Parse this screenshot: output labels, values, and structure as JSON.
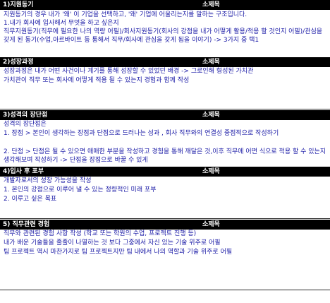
{
  "sections": [
    {
      "title": "1)지원동기",
      "subtitle": "소제목",
      "lines": [
        "지원동기의 경우 내가 '왜' 이 기업을 선택하고, '왜' 기업에 어울리는지를 말하는 구조입니다.",
        "1.내가 회사에 입사해서 무엇을 하고 싶은지",
        "직무지원동기(직무에 필요한 나의 역량 어필)/회사지원동기(회사의 강점을 내가 어떻게 활용/적용 할 것인지 어필)/관심을 갖게 된 동기(수업,아르바이트 등 통해서 직무/회사에 관심을 갖게 됨을 이야기) -> 3가지 중 택1"
      ]
    },
    {
      "title": "2)성장과정",
      "subtitle": "소제목",
      "lines": [
        "성장과정은 내가 어떤 사건이나 계기를 통해 성장할 수 있었던 배경 -> 그로인해 형성된 가치관",
        "가치관이 직무 또는 회사에 어떻게 적용 될 수 있는지 경험과 함께 작성"
      ]
    },
    {
      "title": "3)성격의 장단점",
      "subtitle": "소제목",
      "lines": [
        "성격의 장단점은",
        "1. 장점 > 본인이 생각하는 장점과 단점으로 드러나는 성과 , 회사 직무와의 연결성 중점적으로 작성하기",
        "2. 단점 > 단점은 될 수 있으면 애매한 부분을 작성하고 경험을 통해 깨달은 것,이후 직무에 어떤 식으로 적용 할 수 있는지 생각해보며 작성하기 -> 단점을 장점으로 바꿀 수 있게"
      ]
    },
    {
      "title": "4)입사 후 포부",
      "subtitle": "소제목",
      "lines": [
        "개발자로서의 성장 가능성을 작성",
        "1. 본인의 강점으로 이루어 낼 수 있는 정량적인 미래 포부",
        "2. 이루고 싶은 목표"
      ]
    },
    {
      "title": "5) 직무관련 경험",
      "subtitle": "소제목",
      "lines": [
        "직무와 관련된 경험 사항 작성 (학교 또는 학원의 수업, 프로젝트 진행 등)",
        "내가 배운 기술들을 줄줄이 나열하는 것 보다 그중에서 자신 있는 기술 위주로 어필",
        "팀 프로젝트 역시 마찬가지로 팀 프로젝트지만 팀 내에서 나의 역할과 기술 위주로 어필"
      ]
    }
  ]
}
